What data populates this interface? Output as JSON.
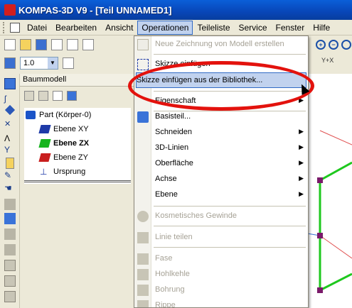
{
  "window": {
    "title": "KOMPAS-3D V9 - [Teil UNNAMED1]"
  },
  "menubar": {
    "items": [
      {
        "label": "Datei"
      },
      {
        "label": "Bearbeiten"
      },
      {
        "label": "Ansicht"
      },
      {
        "label": "Operationen",
        "active": true
      },
      {
        "label": "Teileliste"
      },
      {
        "label": "Service"
      },
      {
        "label": "Fenster"
      },
      {
        "label": "Hilfe"
      }
    ]
  },
  "toolbar": {
    "scale_value": "1.0",
    "coord_label": "Y+X"
  },
  "tree": {
    "header": "Baummodell",
    "items": [
      {
        "label": "Part (Körper-0)"
      },
      {
        "label": "Ebene XY"
      },
      {
        "label": "Ebene ZX"
      },
      {
        "label": "Ebene ZY"
      },
      {
        "label": "Ursprung"
      }
    ]
  },
  "dropdown": {
    "items": [
      {
        "label": "Neue Zeichnung von Modell erstellen",
        "disabled": true,
        "arrow": false
      },
      {
        "label": "Skizze einfügen",
        "disabled": false,
        "arrow": false
      },
      {
        "label": "Skizze einfügen aus der Bibliothek...",
        "disabled": false,
        "arrow": false,
        "highlight": true
      },
      {
        "label": "Eigenschaft",
        "disabled": false,
        "arrow": true
      },
      {
        "label": "Basisteil...",
        "disabled": false,
        "arrow": false
      },
      {
        "label": "Schneiden",
        "disabled": false,
        "arrow": true
      },
      {
        "label": "3D-Linien",
        "disabled": false,
        "arrow": true
      },
      {
        "label": "Oberfläche",
        "disabled": false,
        "arrow": true
      },
      {
        "label": "Achse",
        "disabled": false,
        "arrow": true
      },
      {
        "label": "Ebene",
        "disabled": false,
        "arrow": true
      },
      {
        "label": "Kosmetisches Gewinde",
        "disabled": true,
        "arrow": false
      },
      {
        "label": "Linie teilen",
        "disabled": true,
        "arrow": false
      },
      {
        "label": "Fase",
        "disabled": true,
        "arrow": false
      },
      {
        "label": "Hohlkehle",
        "disabled": true,
        "arrow": false
      },
      {
        "label": "Bohrung",
        "disabled": true,
        "arrow": false
      },
      {
        "label": "Rippe",
        "disabled": true,
        "arrow": false
      }
    ]
  },
  "colors": {
    "annotation_red": "#e3120d",
    "highlight_bg": "#c1d2ee",
    "model_green": "#1ec81e",
    "point_purple": "#7a1a6a"
  }
}
